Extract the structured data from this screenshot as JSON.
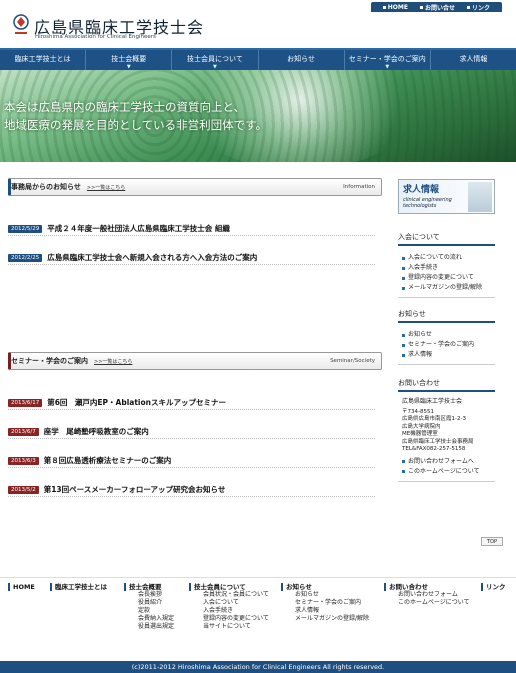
{
  "utility_links": [
    "HOME",
    "お問い合せ",
    "リンク"
  ],
  "header": {
    "title": "広島県臨床工学技士会",
    "subtitle": "Hiroshima Association for Clinical Engineers"
  },
  "global_nav": [
    "臨床工学技士とは",
    "技士会概要",
    "技士会員について",
    "お知らせ",
    "セミナー・学会のご案内",
    "求人情報"
  ],
  "hero": {
    "line1": "本会は広島県内の臨床工学技士の資質向上と、",
    "line2": "地域医療の発展を目的としている非営利団体です。"
  },
  "office_news": {
    "title": "事務局からのお知らせ",
    "more": ">>一覧はこちら",
    "en": "Information",
    "items": [
      {
        "date": "2012/5/29",
        "title": "平成２４年度一般社団法人広島県臨床工学技士会 組織"
      },
      {
        "date": "2012/2/25",
        "title": "広島県臨床工学技士会へ新規入会される方へ入会方法のご案内"
      }
    ]
  },
  "seminar": {
    "title": "セミナー・学会のご案内",
    "more": ">>一覧はこちら",
    "en": "Seminar/Society",
    "items": [
      {
        "date": "2013/6/17",
        "title": "第6回　瀬戸内EP・Ablationスキルアップセミナー"
      },
      {
        "date": "2013/6/7",
        "title": "座学　尾崎塾呼吸教室のご案内"
      },
      {
        "date": "2013/6/3",
        "title": "第８回広島透析療法セミナーのご案内"
      },
      {
        "date": "2013/5/2",
        "title": "第13回ペースメーカーフォローアップ研究会お知らせ"
      }
    ]
  },
  "sidebar": {
    "banner_title": "求人情報",
    "banner_sub1": "clinical engineering",
    "banner_sub2": "technologists",
    "membership": {
      "heading": "入会について",
      "items": [
        "入会についての流れ",
        "入会手続き",
        "登録内容の変更について",
        "メールマガジンの登録/解除"
      ]
    },
    "notices": {
      "heading": "お知らせ",
      "items": [
        "お知らせ",
        "セミナー・学会のご案内",
        "求人情報"
      ]
    },
    "contact": {
      "heading": "お問い合わせ",
      "org": "広島県臨床工学技士会",
      "lines": [
        "〒734-8551",
        "広島県広島市南区霞1-2-3",
        "広島大学病院内",
        "ME機器管理室",
        "広島県臨床工学技士会事務局",
        "TEL&FAX082-257-5158"
      ],
      "items": [
        "お問い合わせフォームへ",
        "このホームページについて"
      ]
    }
  },
  "top_button": "TOP",
  "footer": {
    "home": "HOME",
    "about": "臨床工学技士とは",
    "overview": {
      "heading": "技士会概要",
      "items": [
        "会長挨拶",
        "役員紹介",
        "定款",
        "会費納入規定",
        "役員選出規定"
      ]
    },
    "members": {
      "heading": "技士会員について",
      "items": [
        "会員状況・会員について",
        "入会について",
        "入会手続き",
        "登録内容の変更について",
        "当サイトについて"
      ]
    },
    "news": {
      "heading": "お知らせ",
      "items": [
        "お知らせ",
        "セミナー・学会のご案内",
        "求人情報",
        "メールマガジンの登録/解除"
      ]
    },
    "contact": {
      "heading": "お問い合わせ",
      "items": [
        "お問い合わせフォーム",
        "このホームページについて"
      ]
    },
    "links": "リンク",
    "copyright": "(c)2011-2012 Hiroshima Association for Clinical Engineers All rights reserved."
  }
}
